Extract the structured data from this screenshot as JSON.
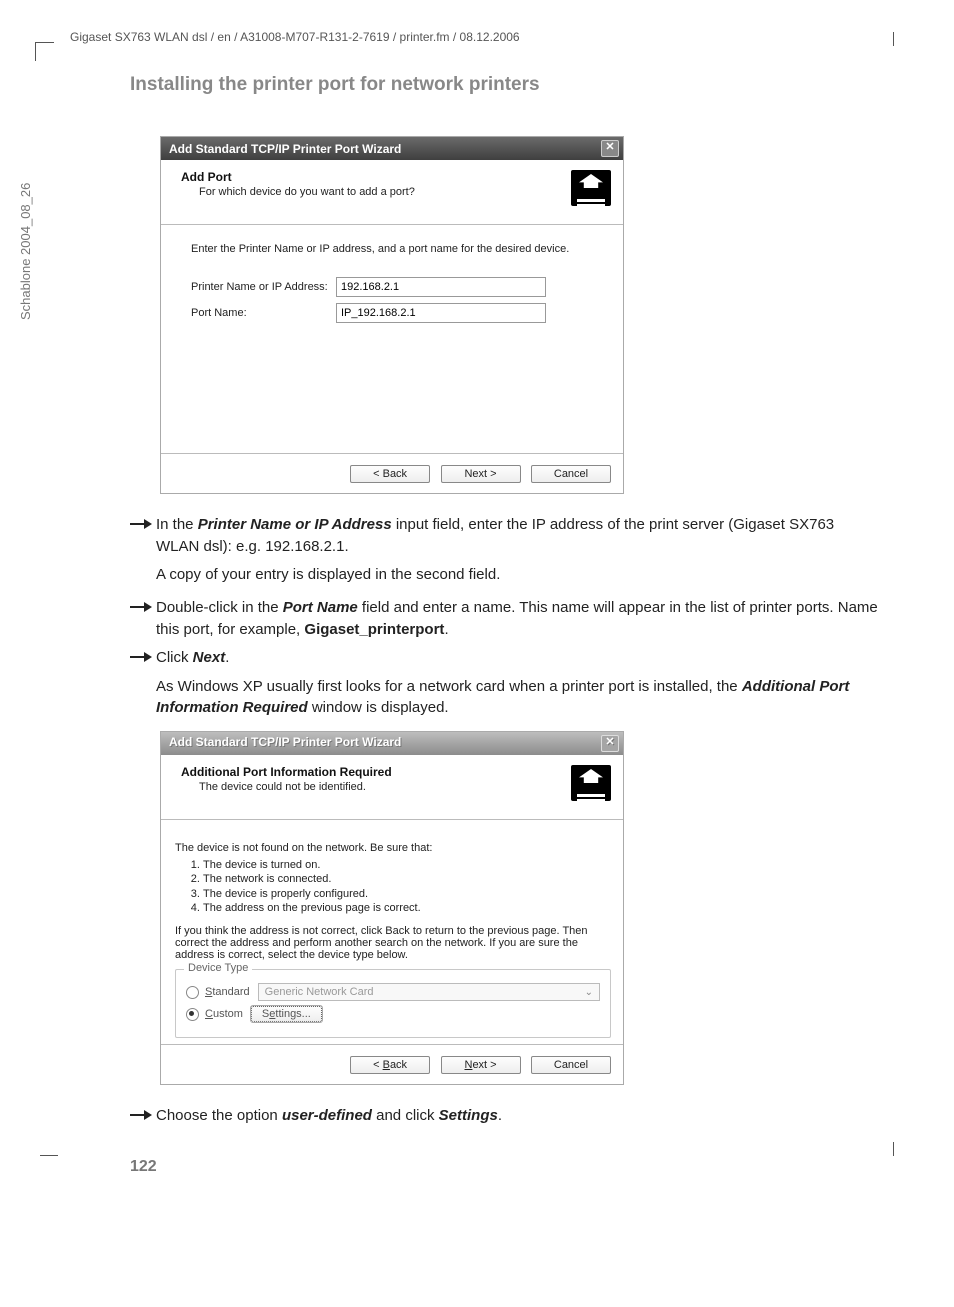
{
  "page": {
    "header": "Gigaset SX763 WLAN dsl / en / A31008-M707-R131-2-7619 / printer.fm / 08.12.2006",
    "sideways": "Schablone 2004_08_26",
    "title": "Installing the printer port for network printers",
    "pagenum": "122"
  },
  "dialog1": {
    "title": "Add Standard TCP/IP Printer Port Wizard",
    "hdr_title": "Add Port",
    "hdr_sub": "For which device do you want to add a port?",
    "instr": "Enter the Printer Name or IP address, and a port name for the desired device.",
    "label_ip": "Printer Name or IP Address:",
    "val_ip": "192.168.2.1",
    "label_port": "Port Name:",
    "val_port": "IP_192.168.2.1",
    "btn_back": "< Back",
    "btn_next": "Next >",
    "btn_cancel": "Cancel"
  },
  "text": {
    "i1_a": "In the ",
    "i1_b": "Printer Name or IP Address",
    "i1_c": " input field, enter the IP address of the print server (Gigaset SX763 WLAN dsl): e.g. 192.168.2.1.",
    "p1": "A copy of your entry is displayed in the second field.",
    "i2_a": "Double-click in the ",
    "i2_b": "Port Name",
    "i2_c": " field and enter a name. This name will appear in the list of printer ports. Name this port, for example, ",
    "i2_d": "Gigaset_printerport",
    "i2_e": ".",
    "i3_a": "Click ",
    "i3_b": "Next",
    "i3_c": ".",
    "p2_a": "As Windows XP usually first looks for a network card when a printer port is installed, the ",
    "p2_b": "Additional Port Information Required",
    "p2_c": " window is displayed.",
    "i4_a": "Choose the option ",
    "i4_b": "user-defined",
    "i4_c": " and click ",
    "i4_d": "Settings",
    "i4_e": "."
  },
  "dialog2": {
    "title": "Add Standard TCP/IP Printer Port Wizard",
    "hdr_title": "Additional Port Information Required",
    "hdr_sub": "The device could not be identified.",
    "line1": "The device is not found on the network. Be sure that:",
    "li1": "The device is turned on.",
    "li2": "The network is connected.",
    "li3": "The device is properly configured.",
    "li4": "The address on the previous page is correct.",
    "para2": "If you think the address is not correct, click Back to return to the previous page. Then correct the address and perform another search on the network. If you are sure the address is correct, select the device type below.",
    "legend": "Device Type",
    "radio_std": "Standard",
    "dd_val": "Generic Network Card",
    "radio_custom": "Custom",
    "settings_btn": "Settings...",
    "btn_back": "< Back",
    "btn_next": "Next >",
    "btn_cancel": "Cancel"
  }
}
